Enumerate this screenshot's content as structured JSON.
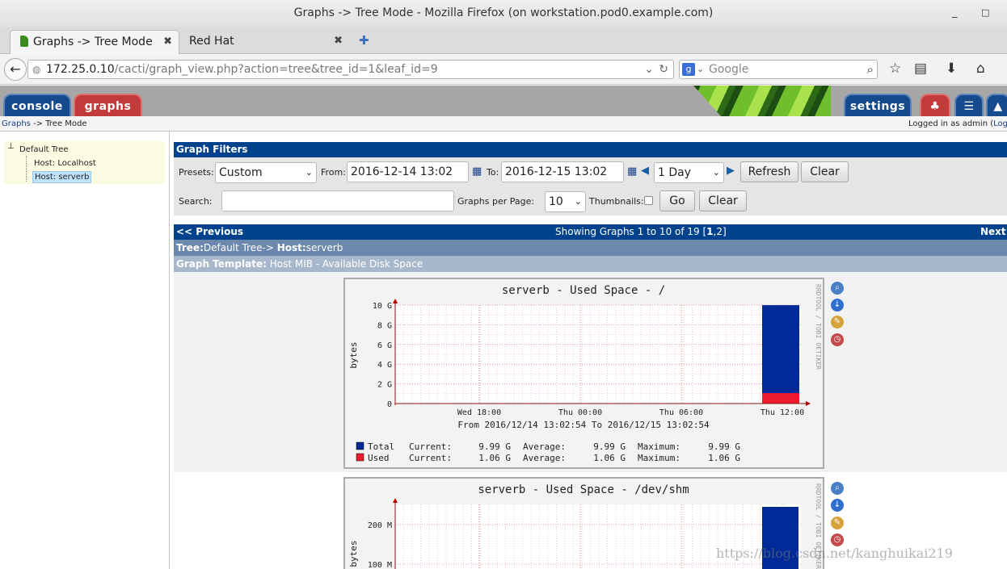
{
  "window": {
    "title": "Graphs -> Tree Mode - Mozilla Firefox (on workstation.pod0.example.com)",
    "minimize": "_",
    "maximize": "□"
  },
  "tabs": [
    {
      "label": "Graphs -> Tree Mode",
      "close": "✖"
    },
    {
      "label": "Red Hat",
      "close": "✖"
    }
  ],
  "new_tab": "✚",
  "url": {
    "host": "172.25.0.10",
    "path": "/cacti/graph_view.php?action=tree&tree_id=1&leaf_id=9"
  },
  "search": {
    "placeholder": "Google"
  },
  "cacti_tabs": {
    "console": "console",
    "graphs": "graphs",
    "settings": "settings"
  },
  "breadcrumb": {
    "link": "Graphs",
    "sep": "->",
    "current": "Tree Mode",
    "logged_in": "Logged in as admin (",
    "logout": "Logo"
  },
  "tree": {
    "root": "Default Tree",
    "items": [
      "Host: Localhost",
      "Host: serverb"
    ]
  },
  "filters": {
    "title": "Graph Filters",
    "presets_label": "Presets:",
    "presets_value": "Custom",
    "from_label": "From:",
    "from_value": "2016-12-14 13:02",
    "to_label": "To:",
    "to_value": "2016-12-15 13:02",
    "timespan_value": "1 Day",
    "refresh": "Refresh",
    "clear": "Clear",
    "search_label": "Search:",
    "gpp_label": "Graphs per Page:",
    "gpp_value": "10",
    "thumb_label": "Thumbnails:",
    "go": "Go",
    "clear2": "Clear"
  },
  "nav": {
    "prev": "<< Previous",
    "showing_prefix": "Showing Graphs 1 to 10 of 19 [",
    "page1": "1",
    "page_sep": ",",
    "page2": "2",
    "showing_suffix": "]",
    "next": "Next >"
  },
  "tree_path": {
    "tree_label": "Tree:",
    "tree_value": "Default Tree-> ",
    "host_label": "Host:",
    "host_value": "serverb"
  },
  "template": {
    "label": "Graph Template:",
    "value": " Host MIB - Available Disk Space"
  },
  "rrdtool_credit": "RRDTOOL / TOBI OETIKER",
  "chart_data": [
    {
      "type": "area",
      "title": "serverb - Used Space - /",
      "ylabel": "bytes",
      "ylim": [
        0,
        10
      ],
      "y_ticks": [
        "10 G",
        "8 G",
        "6 G",
        "4 G",
        "2 G",
        "0"
      ],
      "x_ticks": [
        "Wed 18:00",
        "Thu 00:00",
        "Thu 06:00",
        "Thu 12:00"
      ],
      "subtitle": "From 2016/12/14 13:02:54 To 2016/12/15 13:02:54",
      "series": [
        {
          "name": "Total",
          "color": "#002a97",
          "current": "9.99 G",
          "average": "9.99 G",
          "maximum": "9.99 G",
          "value": 9.99
        },
        {
          "name": "Used",
          "color": "#ea1c2d",
          "current": "1.06 G",
          "average": "1.06 G",
          "maximum": "1.06 G",
          "value": 1.06
        }
      ],
      "legend_labels": {
        "current": "Current:",
        "average": "Average:",
        "maximum": "Maximum:"
      }
    },
    {
      "type": "area",
      "title": "serverb - Used Space - /dev/shm",
      "ylabel": "bytes",
      "y_ticks": [
        "200 M",
        "100 M"
      ]
    }
  ],
  "watermark": "https://blog.csdn.net/kanghuikai219"
}
